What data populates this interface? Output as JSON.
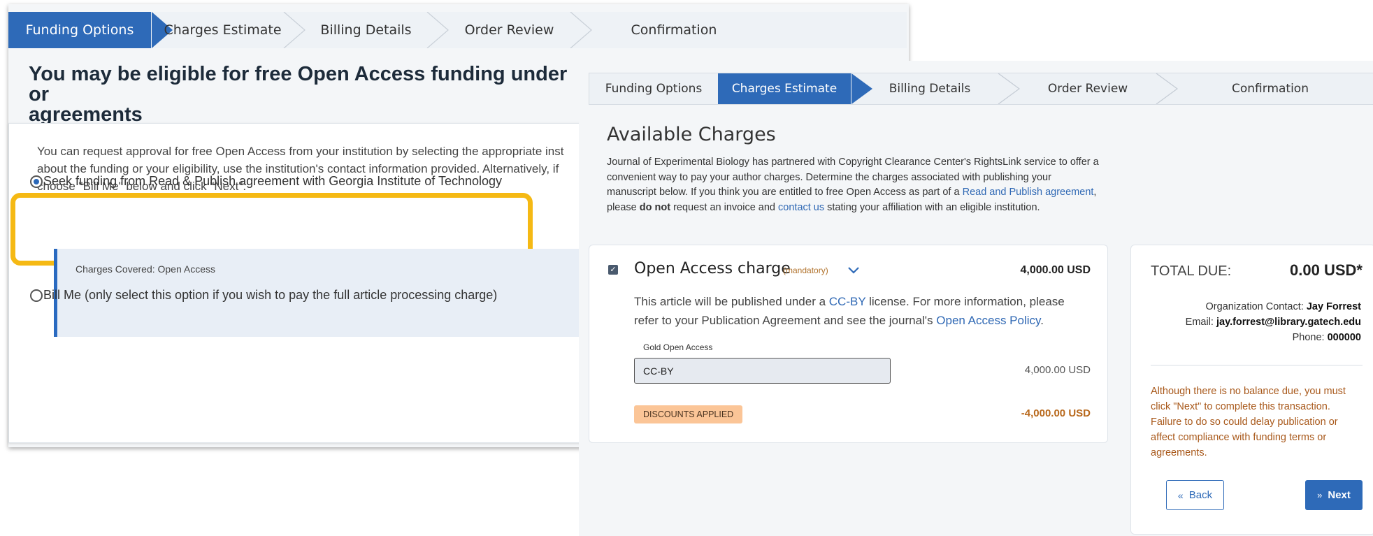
{
  "back_panel": {
    "steps": [
      "Funding Options",
      "Charges Estimate",
      "Billing Details",
      "Order Review",
      "Confirmation"
    ],
    "active_step": 0,
    "title": "You may be eligible for free Open Access funding under or\nagreements",
    "intro": "You can request approval for free Open Access from your institution by selecting the appropriate inst\nabout the funding or your eligibility, use the institution's contact information provided. Alternatively, if\nchoose \"Bill Me\" below and click \"Next\".",
    "option_1": "Seek funding from Read & Publish agreement with Georgia Institute of Technology",
    "option_1_selected": true,
    "charges_covered": "Charges Covered: Open Access",
    "option_2": "Bill Me (only select this option if you wish to pay the full article processing charge)",
    "highlight_color": "#f5b914"
  },
  "front_panel": {
    "steps": [
      "Funding Options",
      "Charges Estimate",
      "Billing Details",
      "Order Review",
      "Confirmation"
    ],
    "active_step": 1,
    "title": "Available Charges",
    "description": {
      "part1": "Journal of Experimental Biology has partnered with Copyright Clearance Center's RightsLink service to offer a convenient way to pay your author charges. Determine the charges associated with publishing your manuscript below. If you think you are entitled to free Open Access as part of a ",
      "link1": "Read and Publish agreement",
      "part2": ", please ",
      "bold": "do not",
      "part3": " request an invoice and ",
      "link2": "contact us",
      "part4": " stating your affiliation with an eligible institution."
    },
    "charge": {
      "title": "Open Access charge",
      "mandatory": "(mandatory)",
      "amount": "4,000.00 USD",
      "license_pre": "This article will be published under a ",
      "license_link": "CC-BY",
      "license_mid": " license. For more information, please refer to your Publication Agreement and see the journal's ",
      "policy_link": "Open Access Policy",
      "license_end": ".",
      "select_label": "Gold Open Access",
      "select_value": "CC-BY",
      "select_amount": "4,000.00 USD",
      "discount_badge": "DISCOUNTS APPLIED",
      "discount_amount": "-4,000.00 USD"
    },
    "total": {
      "label": "TOTAL DUE:",
      "amount": "0.00 USD*",
      "contact_label": "Organization Contact: ",
      "contact_name": "Jay Forrest",
      "email_label": "Email: ",
      "email": "jay.forrest@library.gatech.edu",
      "phone_label": "Phone: ",
      "phone": "000000",
      "warning": "Although there is no balance due, you must click \"Next\" to complete this transaction. Failure to do so could delay publication or affect compliance with funding terms or agreements.",
      "back_label": "Back",
      "next_label": "Next"
    }
  },
  "colors": {
    "accent": "#2e6ab8",
    "warning_text": "#a8581a",
    "discount_badge": "#fbc597"
  }
}
